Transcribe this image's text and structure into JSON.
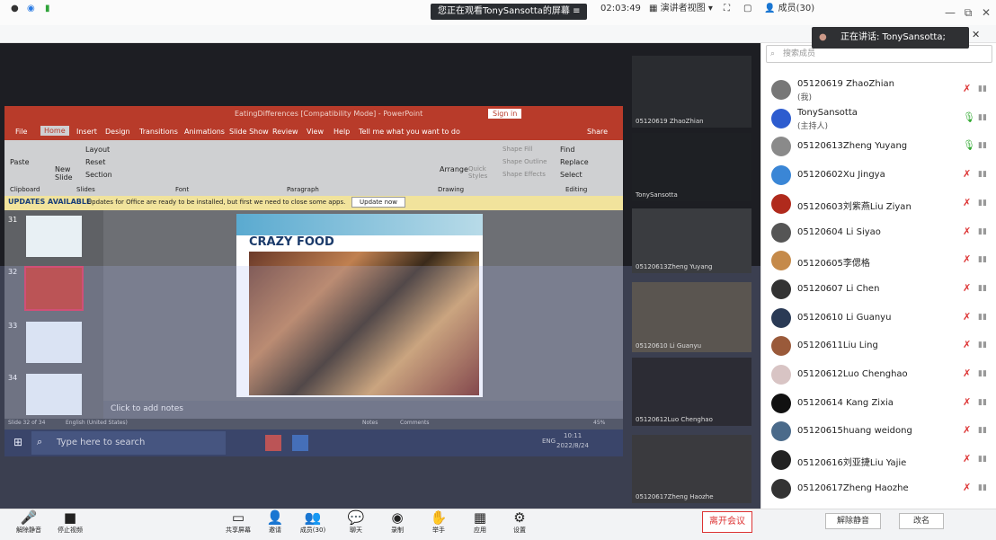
{
  "window": {
    "banner": "您正在观看TonySansotta的屏幕",
    "banner_icon": "menu-icon",
    "controls": [
      "—",
      "⧉",
      "✕"
    ]
  },
  "toolbar": {
    "timer": "02:03:49",
    "view_label": "演讲者视图",
    "members": "成员(30)",
    "speaking": "正在讲话: TonySansotta;"
  },
  "ppt": {
    "title": "EatingDifferences [Compatibility Mode] - PowerPoint",
    "signin": "Sign in",
    "tabs": [
      "File",
      "Home",
      "Insert",
      "Design",
      "Transitions",
      "Animations",
      "Slide Show",
      "Review",
      "View",
      "Help",
      "Tell me what you want to do"
    ],
    "share_label": "Share",
    "groups": [
      "Clipboard",
      "Slides",
      "Font",
      "Paragraph",
      "Drawing",
      "Editing"
    ],
    "buttons": {
      "paste": "Paste",
      "new_slide": "New Slide",
      "layout": "Layout",
      "reset": "Reset",
      "section": "Section",
      "arrange": "Arrange",
      "quick_styles": "Quick Styles",
      "shape_fill": "Shape Fill",
      "shape_outline": "Shape Outline",
      "shape_effects": "Shape Effects",
      "find": "Find",
      "replace": "Replace",
      "select": "Select"
    },
    "update_bold": "UPDATES AVAILABLE",
    "update_msg": "Updates for Office are ready to be installed, but first we need to close some apps.",
    "update_btn": "Update now",
    "thumb_numbers": [
      "31",
      "32",
      "33",
      "34"
    ],
    "slide_title": "CRAZY FOOD",
    "notes": "Click to add notes",
    "status_left": "Slide 32 of 34",
    "status_lang": "English (United States)",
    "status_notes": "Notes",
    "status_comments": "Comments",
    "zoom": "45%"
  },
  "taskbar": {
    "search": "Type here to search",
    "time": "10:11",
    "date": "2022/8/24",
    "lang": "ENG"
  },
  "videos": [
    {
      "name": "05120619 ZhaoZhian"
    },
    {
      "name": "TonySansotta"
    },
    {
      "name": "05120613Zheng Yuyang"
    },
    {
      "name": "05120610 Li Guanyu"
    },
    {
      "name": "05120612Luo Chenghao"
    },
    {
      "name": "05120617Zheng Haozhe"
    }
  ],
  "panel": {
    "search_placeholder": "搜索成员",
    "participants": [
      {
        "name": "05120619 ZhaoZhian",
        "sub": "(我)",
        "color": "#777"
      },
      {
        "name": "TonySansotta",
        "sub": "(主持人)",
        "color": "#2d5ccf"
      },
      {
        "name": "05120613Zheng Yuyang",
        "sub": "",
        "color": "#8a8a8a"
      },
      {
        "name": "05120602Xu Jingya",
        "sub": "",
        "color": "#3a86d6"
      },
      {
        "name": "05120603刘紫燕Liu Ziyan",
        "sub": "",
        "color": "#b02a1c"
      },
      {
        "name": "05120604  Li Siyao",
        "sub": "",
        "color": "#555"
      },
      {
        "name": "05120605李偲格",
        "sub": "",
        "color": "#c58a4a"
      },
      {
        "name": "05120607 Li Chen",
        "sub": "",
        "color": "#333"
      },
      {
        "name": "05120610 Li Guanyu",
        "sub": "",
        "color": "#2a3a55"
      },
      {
        "name": "05120611Liu Ling",
        "sub": "",
        "color": "#9a5a3a"
      },
      {
        "name": "05120612Luo Chenghao",
        "sub": "",
        "color": "#d8c4c4"
      },
      {
        "name": "05120614 Kang Zixia",
        "sub": "",
        "color": "#111"
      },
      {
        "name": "05120615huang weidong",
        "sub": "",
        "color": "#4a6a8a"
      },
      {
        "name": "05120616刘亚捷Liu Yajie",
        "sub": "",
        "color": "#222"
      },
      {
        "name": "05120617Zheng Haozhe",
        "sub": "",
        "color": "#333"
      }
    ],
    "mute_all": "解除静音",
    "rename": "改名"
  },
  "bottom": {
    "buttons": [
      {
        "label": "解除静音",
        "icon": "🎤"
      },
      {
        "label": "停止视频",
        "icon": "■"
      },
      {
        "label": "共享屏幕",
        "icon": "▭"
      },
      {
        "label": "邀请",
        "icon": "👤"
      },
      {
        "label": "成员(30)",
        "icon": "👥"
      },
      {
        "label": "聊天",
        "icon": "💬"
      },
      {
        "label": "录制",
        "icon": "◉"
      },
      {
        "label": "举手",
        "icon": "✋"
      },
      {
        "label": "应用",
        "icon": "▦"
      },
      {
        "label": "设置",
        "icon": "⚙"
      }
    ],
    "leave": "离开会议"
  }
}
